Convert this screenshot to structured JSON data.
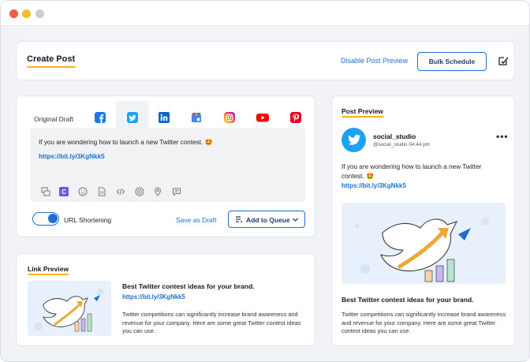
{
  "header": {
    "title": "Create Post",
    "disable_preview": "Disable Post Preview",
    "bulk_schedule": "Bulk Schedule"
  },
  "editor": {
    "tabs": [
      {
        "label": "Original Draft"
      },
      {
        "icon": "facebook-icon"
      },
      {
        "icon": "twitter-icon",
        "active": true
      },
      {
        "icon": "linkedin-icon"
      },
      {
        "icon": "google-business-icon"
      },
      {
        "icon": "instagram-icon"
      },
      {
        "icon": "youtube-icon"
      },
      {
        "icon": "pinterest-icon"
      }
    ],
    "text": "If you are wondering how to launch a new Twitter contest. 🤩",
    "link": "https://bit.ly/3KgNkk5",
    "url_shortening": "URL Shortening",
    "save_draft": "Save as Draft",
    "add_to_queue": "Add to Queue"
  },
  "link_preview": {
    "title": "Link Preview",
    "headline": "Best Twitter contest ideas for your brand.",
    "link": "https://bit.ly/3KgNkk5",
    "description": "Twitter competitions can significantly increase brand awareness and revenue for your company. Here are some great Twitter contest ideas you can use."
  },
  "post_preview": {
    "title": "Post Preview",
    "name": "social_studio",
    "handle_time": "@social_studio  04:44 pm",
    "more": "•••",
    "text": "If you are wondering how to launch a new Twitter contest. 🤩",
    "link": "https://bit.ly/3KgNkk5",
    "headline": "Best Twitter contest ideas for your brand.",
    "description": "Twitter competitions can significantly increase brand awareness and revenue for your company. Here are some great Twitter contest ideas you can use."
  },
  "colors": {
    "accent": "#1f6fd1",
    "underline": "#f6b31a",
    "twitter": "#1da1f2"
  }
}
